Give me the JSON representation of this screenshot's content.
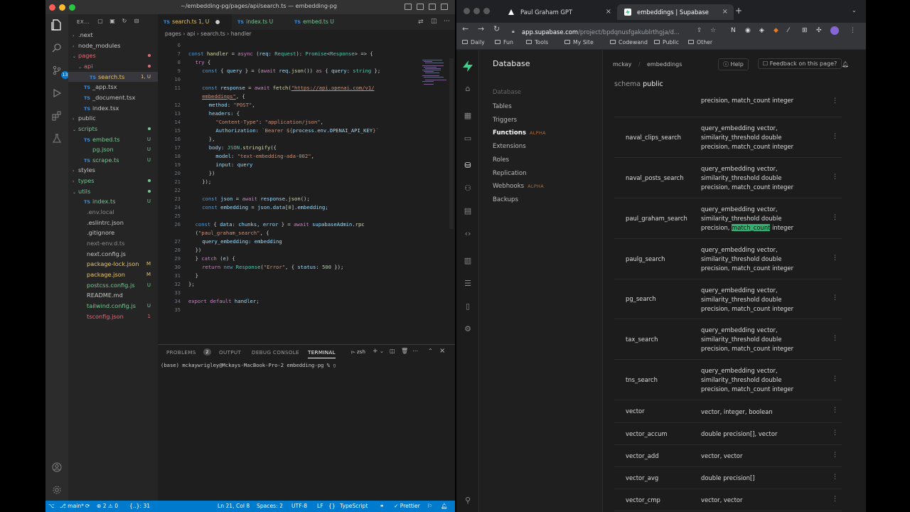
{
  "vscode": {
    "title": "~/embedding-pg/pages/api/search.ts — embedding-pg",
    "explorer_label": "EX...",
    "tree": [
      {
        "label": ".next",
        "indent": 0,
        "chev": "›",
        "color": "#c5c5c5",
        "badge": "",
        "ts": false
      },
      {
        "label": "node_modules",
        "indent": 0,
        "chev": "›",
        "color": "#c5c5c5",
        "badge": "",
        "ts": false
      },
      {
        "label": "pages",
        "indent": 0,
        "chev": "⌄",
        "color": "#e06c75",
        "badge": "dot",
        "ts": false
      },
      {
        "label": "api",
        "indent": 1,
        "chev": "⌄",
        "color": "#e06c75",
        "badge": "dot",
        "ts": false
      },
      {
        "label": "search.ts",
        "indent": 2,
        "chev": "",
        "color": "#e8c66d",
        "badge": "1, U",
        "ts": true,
        "selected": true
      },
      {
        "label": "_app.tsx",
        "indent": 1,
        "chev": "",
        "color": "#c5c5c5",
        "badge": "",
        "ts": true
      },
      {
        "label": "_document.tsx",
        "indent": 1,
        "chev": "",
        "color": "#c5c5c5",
        "badge": "",
        "ts": true
      },
      {
        "label": "index.tsx",
        "indent": 1,
        "chev": "",
        "color": "#c5c5c5",
        "badge": "",
        "ts": true
      },
      {
        "label": "public",
        "indent": 0,
        "chev": "›",
        "color": "#c5c5c5",
        "badge": "",
        "ts": false
      },
      {
        "label": "scripts",
        "indent": 0,
        "chev": "⌄",
        "color": "#73c991",
        "badge": "gdot",
        "ts": false
      },
      {
        "label": "embed.ts",
        "indent": 1,
        "chev": "",
        "color": "#73c991",
        "badge": "U",
        "ts": true
      },
      {
        "label": "pg.json",
        "indent": 1,
        "chev": "",
        "color": "#73c991",
        "badge": "U",
        "ts": false
      },
      {
        "label": "scrape.ts",
        "indent": 1,
        "chev": "",
        "color": "#73c991",
        "badge": "U",
        "ts": true
      },
      {
        "label": "styles",
        "indent": 0,
        "chev": "›",
        "color": "#c5c5c5",
        "badge": "",
        "ts": false
      },
      {
        "label": "types",
        "indent": 0,
        "chev": "›",
        "color": "#73c991",
        "badge": "gdot",
        "ts": false
      },
      {
        "label": "utils",
        "indent": 0,
        "chev": "⌄",
        "color": "#73c991",
        "badge": "gdot",
        "ts": false
      },
      {
        "label": "index.ts",
        "indent": 1,
        "chev": "",
        "color": "#73c991",
        "badge": "U",
        "ts": true
      },
      {
        "label": ".env.local",
        "indent": 0,
        "chev": "",
        "color": "#8a8a8a",
        "badge": "",
        "ts": false
      },
      {
        "label": ".eslintrc.json",
        "indent": 0,
        "chev": "",
        "color": "#c5c5c5",
        "badge": "",
        "ts": false
      },
      {
        "label": ".gitignore",
        "indent": 0,
        "chev": "",
        "color": "#c5c5c5",
        "badge": "",
        "ts": false
      },
      {
        "label": "next-env.d.ts",
        "indent": 0,
        "chev": "",
        "color": "#8a8a8a",
        "badge": "",
        "ts": false
      },
      {
        "label": "next.config.js",
        "indent": 0,
        "chev": "",
        "color": "#c5c5c5",
        "badge": "",
        "ts": false
      },
      {
        "label": "package-lock.json",
        "indent": 0,
        "chev": "",
        "color": "#e8c66d",
        "badge": "M",
        "ts": false
      },
      {
        "label": "package.json",
        "indent": 0,
        "chev": "",
        "color": "#e8c66d",
        "badge": "M",
        "ts": false
      },
      {
        "label": "postcss.config.js",
        "indent": 0,
        "chev": "",
        "color": "#73c991",
        "badge": "U",
        "ts": false
      },
      {
        "label": "README.md",
        "indent": 0,
        "chev": "",
        "color": "#c5c5c5",
        "badge": "",
        "ts": false
      },
      {
        "label": "tailwind.config.js",
        "indent": 0,
        "chev": "",
        "color": "#73c991",
        "badge": "U",
        "ts": false
      },
      {
        "label": "tsconfig.json",
        "indent": 0,
        "chev": "",
        "color": "#e06c75",
        "badge": "1",
        "ts": false
      }
    ],
    "tabs": [
      {
        "label": "search.ts",
        "suffix": "1, U",
        "active": true
      },
      {
        "label": "index.ts",
        "suffix": "U",
        "active": false
      },
      {
        "label": "embed.ts",
        "suffix": "U",
        "active": false
      }
    ],
    "breadcrumb": [
      "pages",
      "api",
      "search.ts",
      "handler"
    ],
    "code": [
      {
        "n": "6",
        "h": "",
        "indent": 0
      },
      {
        "n": "7",
        "h": "<span class='kb'>const</span> <span class='fn'>handler</span> = <span class='kw'>async</span> (<span class='vr'>req</span>: <span class='ty'>Request</span>): <span class='ty'>Promise</span>&lt;<span class='ty'>Response</span>&gt; =&gt; {",
        "indent": 0
      },
      {
        "n": "8",
        "h": "<span class='kw'>try</span> {",
        "indent": 1
      },
      {
        "n": "9",
        "h": "<span class='kb'>const</span> { <span class='vr'>query</span> } = (<span class='kw'>await</span> <span class='vr'>req</span>.<span class='fn'>json</span>()) <span class='kw'>as</span> { <span class='vr'>query</span>: <span class='ty'>string</span> };",
        "indent": 2
      },
      {
        "n": "10",
        "h": "",
        "indent": 0
      },
      {
        "n": "11",
        "h": "<span class='kb'>const</span> <span class='vr'>response</span> = <span class='kw'>await</span> <span class='fn'>fetch</span>(<span class='url'>\"https://api.openai.com/v1/</span>",
        "indent": 2
      },
      {
        "n": "",
        "h": "<span class='url'>embeddings\"</span>, {",
        "indent": 2
      },
      {
        "n": "12",
        "h": "<span class='vr'>method</span>: <span class='str'>\"POST\"</span>,",
        "indent": 3
      },
      {
        "n": "13",
        "h": "<span class='vr'>headers</span>: {",
        "indent": 3
      },
      {
        "n": "14",
        "h": "<span class='str'>\"Content-Type\"</span>: <span class='str'>\"application/json\"</span>,",
        "indent": 4
      },
      {
        "n": "15",
        "h": "<span class='vr'>Authorization</span>: <span class='str'>`Bearer ${</span><span class='vr'>process</span>.<span class='vr'>env</span>.<span class='vr'>OPENAI_API_KEY</span><span class='str'>}`</span>",
        "indent": 4
      },
      {
        "n": "16",
        "h": "},",
        "indent": 3
      },
      {
        "n": "17",
        "h": "<span class='vr'>body</span>: <span class='ty'>JSON</span>.<span class='fn'>stringify</span>({",
        "indent": 3
      },
      {
        "n": "18",
        "h": "<span class='vr'>model</span>: <span class='str'>\"text-embedding-ada-002\"</span>,",
        "indent": 4
      },
      {
        "n": "19",
        "h": "<span class='vr'>input</span>: <span class='vr'>query</span>",
        "indent": 4
      },
      {
        "n": "20",
        "h": "})",
        "indent": 3
      },
      {
        "n": "21",
        "h": "});",
        "indent": 2
      },
      {
        "n": "22",
        "h": "",
        "indent": 0
      },
      {
        "n": "23",
        "h": "<span class='kb'>const</span> <span class='vr'>json</span> = <span class='kw'>await</span> <span class='vr'>response</span>.<span class='fn'>json</span>();",
        "indent": 2
      },
      {
        "n": "24",
        "h": "<span class='kb'>const</span> <span class='vr'>embedding</span> = <span class='vr'>json</span>.<span class='vr'>data</span>[<span class='nu'>0</span>].<span class='vr'>embedding</span>;",
        "indent": 2
      },
      {
        "n": "25",
        "h": "",
        "indent": 0
      },
      {
        "n": "26",
        "h": "<span class='kb'>const</span> { <span class='vr'>data</span>: <span class='vr'>chunks</span>, <span class='vr'>error</span> } = <span class='kw'>await</span> <span class='vr'>supabaseAdmin</span>.<span class='fn'>rpc</span>",
        "indent": 1
      },
      {
        "n": "",
        "h": "(<span class='str'>\"paul_graham_search\"</span>, {",
        "indent": 1
      },
      {
        "n": "27",
        "h": "<span class='vr'>query_embedding</span>: <span class='vr'>embedding</span>",
        "indent": 2
      },
      {
        "n": "28",
        "h": "})",
        "indent": 1
      },
      {
        "n": "29",
        "h": "} <span class='kw'>catch</span> (<span class='vr'>e</span>) {",
        "indent": 1
      },
      {
        "n": "30",
        "h": "<span class='kw'>return</span> <span class='kb'>new</span> <span class='ty'>Response</span>(<span class='str'>\"Error\"</span>, { <span class='vr'>status</span>: <span class='nu'>500</span> });",
        "indent": 2
      },
      {
        "n": "31",
        "h": "}",
        "indent": 1
      },
      {
        "n": "32",
        "h": "};",
        "indent": 0
      },
      {
        "n": "33",
        "h": "",
        "indent": 0
      },
      {
        "n": "34",
        "h": "<span class='kw'>export</span> <span class='kw'>default</span> <span class='vr'>handler</span>;",
        "indent": 0
      },
      {
        "n": "35",
        "h": "",
        "indent": 0
      }
    ],
    "panel": {
      "tabs": [
        "PROBLEMS",
        "OUTPUT",
        "DEBUG CONSOLE",
        "TERMINAL"
      ],
      "problems_count": "2",
      "shell": "zsh",
      "terminal_line": "(base) mckaywrigley@Mckays-MacBook-Pro-2 embedding-pg % ▯"
    },
    "status": {
      "branch": "main*",
      "errors": "⊗ 2 ⚠ 0",
      "ts_info": "{..}: 31",
      "position": "Ln 21, Col 8",
      "spaces": "Spaces: 2",
      "encoding": "UTF-8",
      "eol": "LF",
      "language": "TypeScript",
      "prettier": "✓ Prettier"
    }
  },
  "browser": {
    "tabs": [
      {
        "label": "Paul Graham GPT",
        "active": false
      },
      {
        "label": "embeddings | Supabase",
        "active": true
      }
    ],
    "url_host": "app.supabase.com",
    "url_path": "/project/bpdqnusfgakublrthgja/d...",
    "bookmarks": [
      "Daily",
      "Fun",
      "Tools",
      "My Site",
      "Codewand",
      "Public",
      "Other"
    ],
    "supabase": {
      "section_title": "Database",
      "nav_subtitle": "Database",
      "nav": [
        {
          "label": "Tables",
          "alpha": ""
        },
        {
          "label": "Triggers",
          "alpha": ""
        },
        {
          "label": "Functions",
          "alpha": "ALPHA",
          "active": true
        },
        {
          "label": "Extensions",
          "alpha": ""
        },
        {
          "label": "Roles",
          "alpha": ""
        },
        {
          "label": "Replication",
          "alpha": ""
        },
        {
          "label": "Webhooks",
          "alpha": "ALPHA"
        },
        {
          "label": "Backups",
          "alpha": ""
        }
      ],
      "crumbs": [
        "mckay",
        "embeddings"
      ],
      "help": "Help",
      "feedback": "Feedback on this page?",
      "schema_label": "schema",
      "schema_value": "public",
      "functions": [
        {
          "name": "",
          "args": [
            "precision, match_count integer"
          ]
        },
        {
          "name": "naval_clips_search",
          "args": [
            "query_embedding vector,",
            "similarity_threshold double",
            "precision, match_count integer"
          ]
        },
        {
          "name": "naval_posts_search",
          "args": [
            "query_embedding vector,",
            "similarity_threshold double",
            "precision, match_count integer"
          ]
        },
        {
          "name": "paul_graham_search",
          "args": [
            "query_embedding vector,",
            "similarity_threshold double",
            "precision, |match_count| integer"
          ]
        },
        {
          "name": "paulg_search",
          "args": [
            "query_embedding vector,",
            "similarity_threshold double",
            "precision, match_count integer"
          ]
        },
        {
          "name": "pg_search",
          "args": [
            "query_embedding vector,",
            "similarity_threshold double",
            "precision, match_count integer"
          ]
        },
        {
          "name": "tax_search",
          "args": [
            "query_embedding vector,",
            "similarity_threshold double",
            "precision, match_count integer"
          ]
        },
        {
          "name": "tns_search",
          "args": [
            "query_embedding vector,",
            "similarity_threshold double",
            "precision, match_count integer"
          ]
        },
        {
          "name": "vector",
          "args": [
            "vector, integer, boolean"
          ]
        },
        {
          "name": "vector_accum",
          "args": [
            "double precision[], vector"
          ]
        },
        {
          "name": "vector_add",
          "args": [
            "vector, vector"
          ]
        },
        {
          "name": "vector_avg",
          "args": [
            "double precision[]"
          ]
        },
        {
          "name": "vector_cmp",
          "args": [
            "vector, vector"
          ]
        }
      ]
    }
  }
}
